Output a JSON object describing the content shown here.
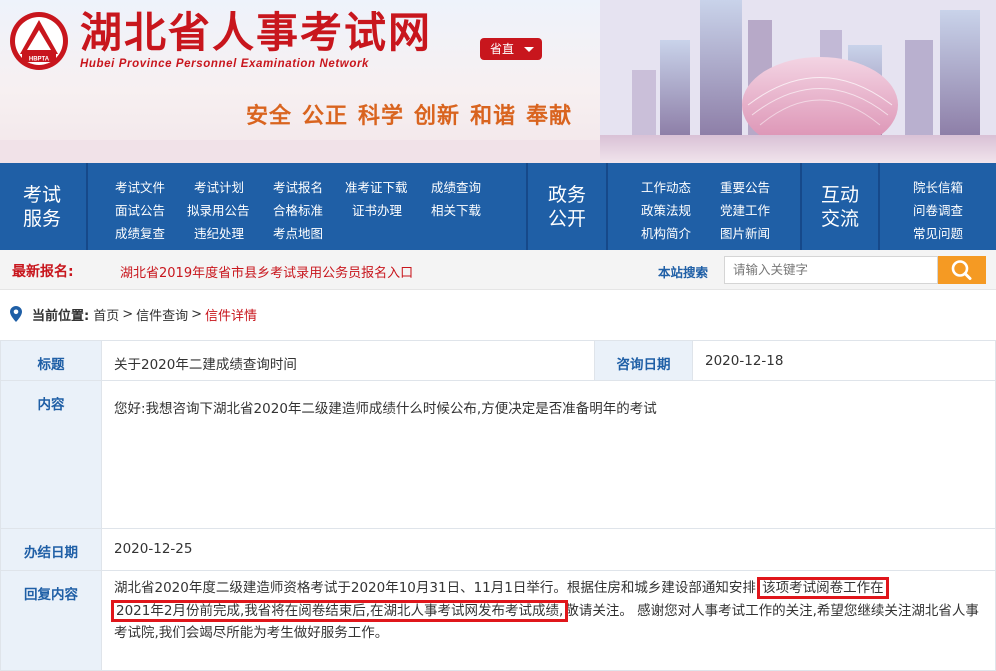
{
  "header": {
    "site_title": "湖北省人事考试网",
    "site_subtitle": "Hubei Province Personnel Examination Network",
    "logo_text": "HBPTA",
    "region_button": "省直",
    "slogan": [
      "安全",
      "公正",
      "科学",
      "创新",
      "和谐",
      "奉献"
    ]
  },
  "nav": {
    "sections": [
      {
        "title_line1": "考试",
        "title_line2": "服务",
        "links": [
          [
            "考试文件",
            "考试计划",
            "考试报名",
            "准考证下载",
            "成绩查询"
          ],
          [
            "面试公告",
            "拟录用公告",
            "合格标准",
            "证书办理",
            "相关下载"
          ],
          [
            "成绩复查",
            "违纪处理",
            "考点地图"
          ]
        ]
      },
      {
        "title_line1": "政务",
        "title_line2": "公开",
        "links": [
          [
            "工作动态",
            "重要公告"
          ],
          [
            "政策法规",
            "党建工作"
          ],
          [
            "机构简介",
            "图片新闻"
          ]
        ]
      },
      {
        "title_line1": "互动",
        "title_line2": "交流",
        "links": [
          [
            "院长信箱"
          ],
          [
            "问卷调查"
          ],
          [
            "常见问题"
          ]
        ]
      }
    ]
  },
  "latest": {
    "label": "最新报名:",
    "news": "湖北省2019年度省市县乡考试录用公务员报名入口",
    "search_label": "本站搜索",
    "search_placeholder": "请输入关键字"
  },
  "breadcrumb": {
    "label": "当前位置:",
    "items": [
      "首页",
      "信件查询",
      "信件详情"
    ],
    "separator": ">"
  },
  "letter": {
    "title_label": "标题",
    "title": "关于2020年二建成绩查询时间",
    "date_label": "咨询日期",
    "date": "2020-12-18",
    "content_label": "内容",
    "content": "您好:我想咨询下湖北省2020年二级建造师成绩什么时候公布,方便决定是否准备明年的考试",
    "done_label": "办结日期",
    "done_date": "2020-12-25",
    "reply_label": "回复内容",
    "reply_part1": "湖北省2020年度二级建造师资格考试于2020年10月31日、11月1日举行。根据住房和城乡建设部通知安排,",
    "reply_highlight1": "该项考试阅卷工作在",
    "reply_highlight2": "2021年2月份前完成,我省将在阅卷结束后,在湖北人事考试网发布考试成绩,",
    "reply_part2": "敬请关注。 感谢您对人事考试工作的关注,希望您继续关注湖北省人事考试院,我们会竭尽所能为考生做好服务工作。"
  },
  "colors": {
    "brand_red": "#c8161d",
    "nav_blue": "#1f5fa6",
    "slogan_orange": "#d9641f",
    "search_orange": "#f59a23",
    "label_bg": "#eaf1f9",
    "highlight_box": "#e0161b"
  }
}
